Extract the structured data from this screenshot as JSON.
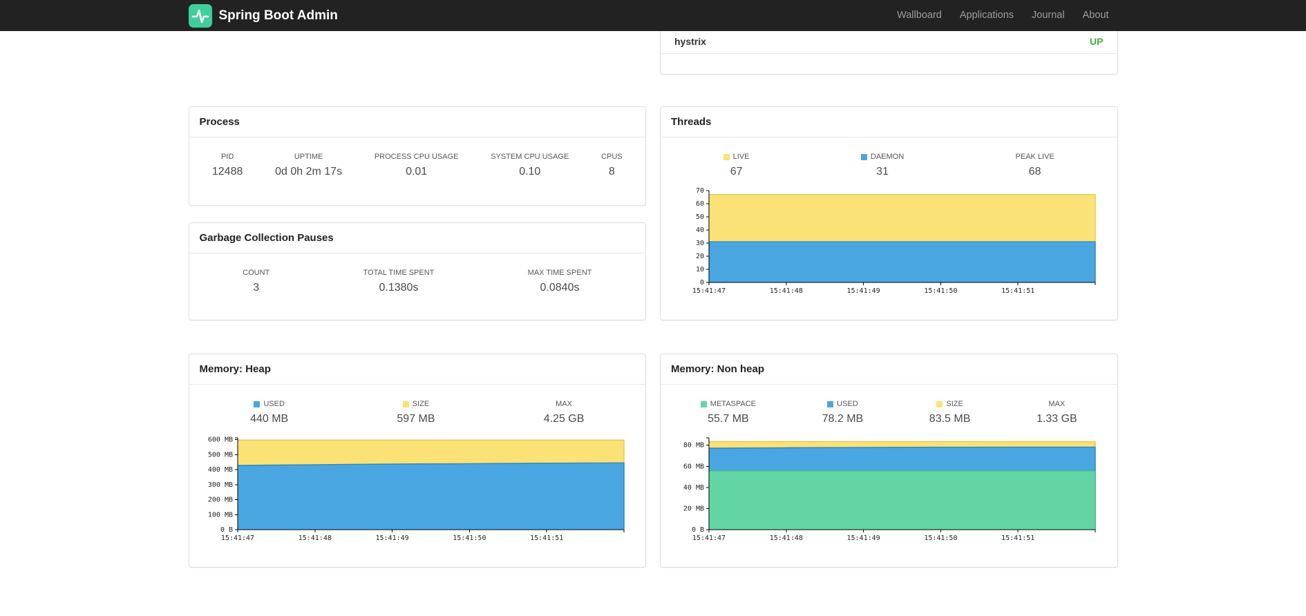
{
  "navbar": {
    "brand": "Spring Boot Admin",
    "items": [
      {
        "label": "Wallboard"
      },
      {
        "label": "Applications"
      },
      {
        "label": "Journal"
      },
      {
        "label": "About"
      }
    ]
  },
  "colors": {
    "brand_green": "#3ecf9b",
    "status_up": "#3fae3f",
    "series_blue": "#4aa6e0",
    "series_yellow": "#fbe276",
    "series_green": "#63d5a5"
  },
  "health": {
    "application": "hystrix",
    "status": "UP"
  },
  "panels": {
    "process": {
      "title": "Process",
      "stats": [
        {
          "label": "PID",
          "value": "12488"
        },
        {
          "label": "UPTIME",
          "value": "0d 0h 2m 17s"
        },
        {
          "label": "PROCESS CPU USAGE",
          "value": "0.01"
        },
        {
          "label": "SYSTEM CPU USAGE",
          "value": "0.10"
        },
        {
          "label": "CPUS",
          "value": "8"
        }
      ]
    },
    "gc": {
      "title": "Garbage Collection Pauses",
      "stats": [
        {
          "label": "COUNT",
          "value": "3"
        },
        {
          "label": "TOTAL TIME SPENT",
          "value": "0.1380s"
        },
        {
          "label": "MAX TIME SPENT",
          "value": "0.0840s"
        }
      ]
    },
    "threads": {
      "title": "Threads",
      "stats": [
        {
          "label": "LIVE",
          "value": "67",
          "swatch": "#fbe276"
        },
        {
          "label": "DAEMON",
          "value": "31",
          "swatch": "#4aa6e0"
        },
        {
          "label": "PEAK LIVE",
          "value": "68"
        }
      ]
    },
    "heap": {
      "title": "Memory: Heap",
      "stats": [
        {
          "label": "USED",
          "value": "440 MB",
          "swatch": "#4aa6e0"
        },
        {
          "label": "SIZE",
          "value": "597 MB",
          "swatch": "#fbe276"
        },
        {
          "label": "MAX",
          "value": "4.25 GB"
        }
      ]
    },
    "nonheap": {
      "title": "Memory: Non heap",
      "stats": [
        {
          "label": "METASPACE",
          "value": "55.7 MB",
          "swatch": "#63d5a5"
        },
        {
          "label": "USED",
          "value": "78.2 MB",
          "swatch": "#4aa6e0"
        },
        {
          "label": "SIZE",
          "value": "83.5 MB",
          "swatch": "#fbe276"
        },
        {
          "label": "MAX",
          "value": "1.33 GB"
        }
      ]
    }
  },
  "chart_data": [
    {
      "key": "threads",
      "type": "area",
      "title": "Threads",
      "stacked_view": "layered",
      "grid": false,
      "legend_position": "top",
      "x_labels": [
        "15:41:47",
        "15:41:48",
        "15:41:49",
        "15:41:50",
        "15:41:51"
      ],
      "ylim": [
        0,
        70
      ],
      "yticks": [
        {
          "v": 0,
          "label": "0"
        },
        {
          "v": 10,
          "label": "10"
        },
        {
          "v": 20,
          "label": "20"
        },
        {
          "v": 30,
          "label": "30"
        },
        {
          "v": 40,
          "label": "40"
        },
        {
          "v": 50,
          "label": "50"
        },
        {
          "v": 60,
          "label": "60"
        },
        {
          "v": 70,
          "label": "70"
        }
      ],
      "series": [
        {
          "name": "LIVE",
          "color": "#fbe276",
          "edge": "#e3c84e",
          "values": [
            67,
            67,
            67,
            67,
            67,
            67
          ]
        },
        {
          "name": "DAEMON",
          "color": "#4aa6e0",
          "edge": "#2e86c1",
          "values": [
            31,
            31,
            31,
            31,
            31,
            31
          ]
        }
      ]
    },
    {
      "key": "heap",
      "type": "area",
      "title": "Memory: Heap",
      "stacked_view": "layered",
      "grid": false,
      "legend_position": "top",
      "x_labels": [
        "15:41:47",
        "15:41:48",
        "15:41:49",
        "15:41:50",
        "15:41:51"
      ],
      "ylim": [
        0,
        612
      ],
      "yticks": [
        {
          "v": 0,
          "label": "0 B"
        },
        {
          "v": 100,
          "label": "100 MB"
        },
        {
          "v": 200,
          "label": "200 MB"
        },
        {
          "v": 300,
          "label": "300 MB"
        },
        {
          "v": 400,
          "label": "400 MB"
        },
        {
          "v": 500,
          "label": "500 MB"
        },
        {
          "v": 600,
          "label": "600 MB"
        }
      ],
      "series": [
        {
          "name": "USED",
          "color": "#4aa6e0",
          "edge": "#2e86c1",
          "values": [
            428,
            433,
            437,
            440,
            443,
            445
          ]
        },
        {
          "name": "SIZE",
          "color": "#fbe276",
          "edge": "#e3c84e",
          "values": [
            597,
            597,
            597,
            597,
            597,
            597
          ]
        }
      ]
    },
    {
      "key": "nonheap",
      "type": "area",
      "title": "Memory: Non heap",
      "stacked_view": "layered",
      "grid": false,
      "legend_position": "top",
      "x_labels": [
        "15:41:47",
        "15:41:48",
        "15:41:49",
        "15:41:50",
        "15:41:51"
      ],
      "ylim": [
        0,
        87
      ],
      "yticks": [
        {
          "v": 0,
          "label": "0 B"
        },
        {
          "v": 20,
          "label": "20 MB"
        },
        {
          "v": 40,
          "label": "40 MB"
        },
        {
          "v": 60,
          "label": "60 MB"
        },
        {
          "v": 80,
          "label": "80 MB"
        }
      ],
      "series": [
        {
          "name": "METASPACE",
          "color": "#63d5a5",
          "edge": "#43bd8b",
          "values": [
            55.7,
            55.7,
            55.7,
            55.7,
            55.7,
            55.7
          ]
        },
        {
          "name": "USED",
          "color": "#4aa6e0",
          "edge": "#2e86c1",
          "values": [
            77.2,
            77.6,
            77.9,
            78.1,
            78.2,
            78.2
          ]
        },
        {
          "name": "SIZE",
          "color": "#fbe276",
          "edge": "#e3c84e",
          "values": [
            83.5,
            83.5,
            83.5,
            83.5,
            83.5,
            83.5
          ]
        }
      ]
    }
  ]
}
